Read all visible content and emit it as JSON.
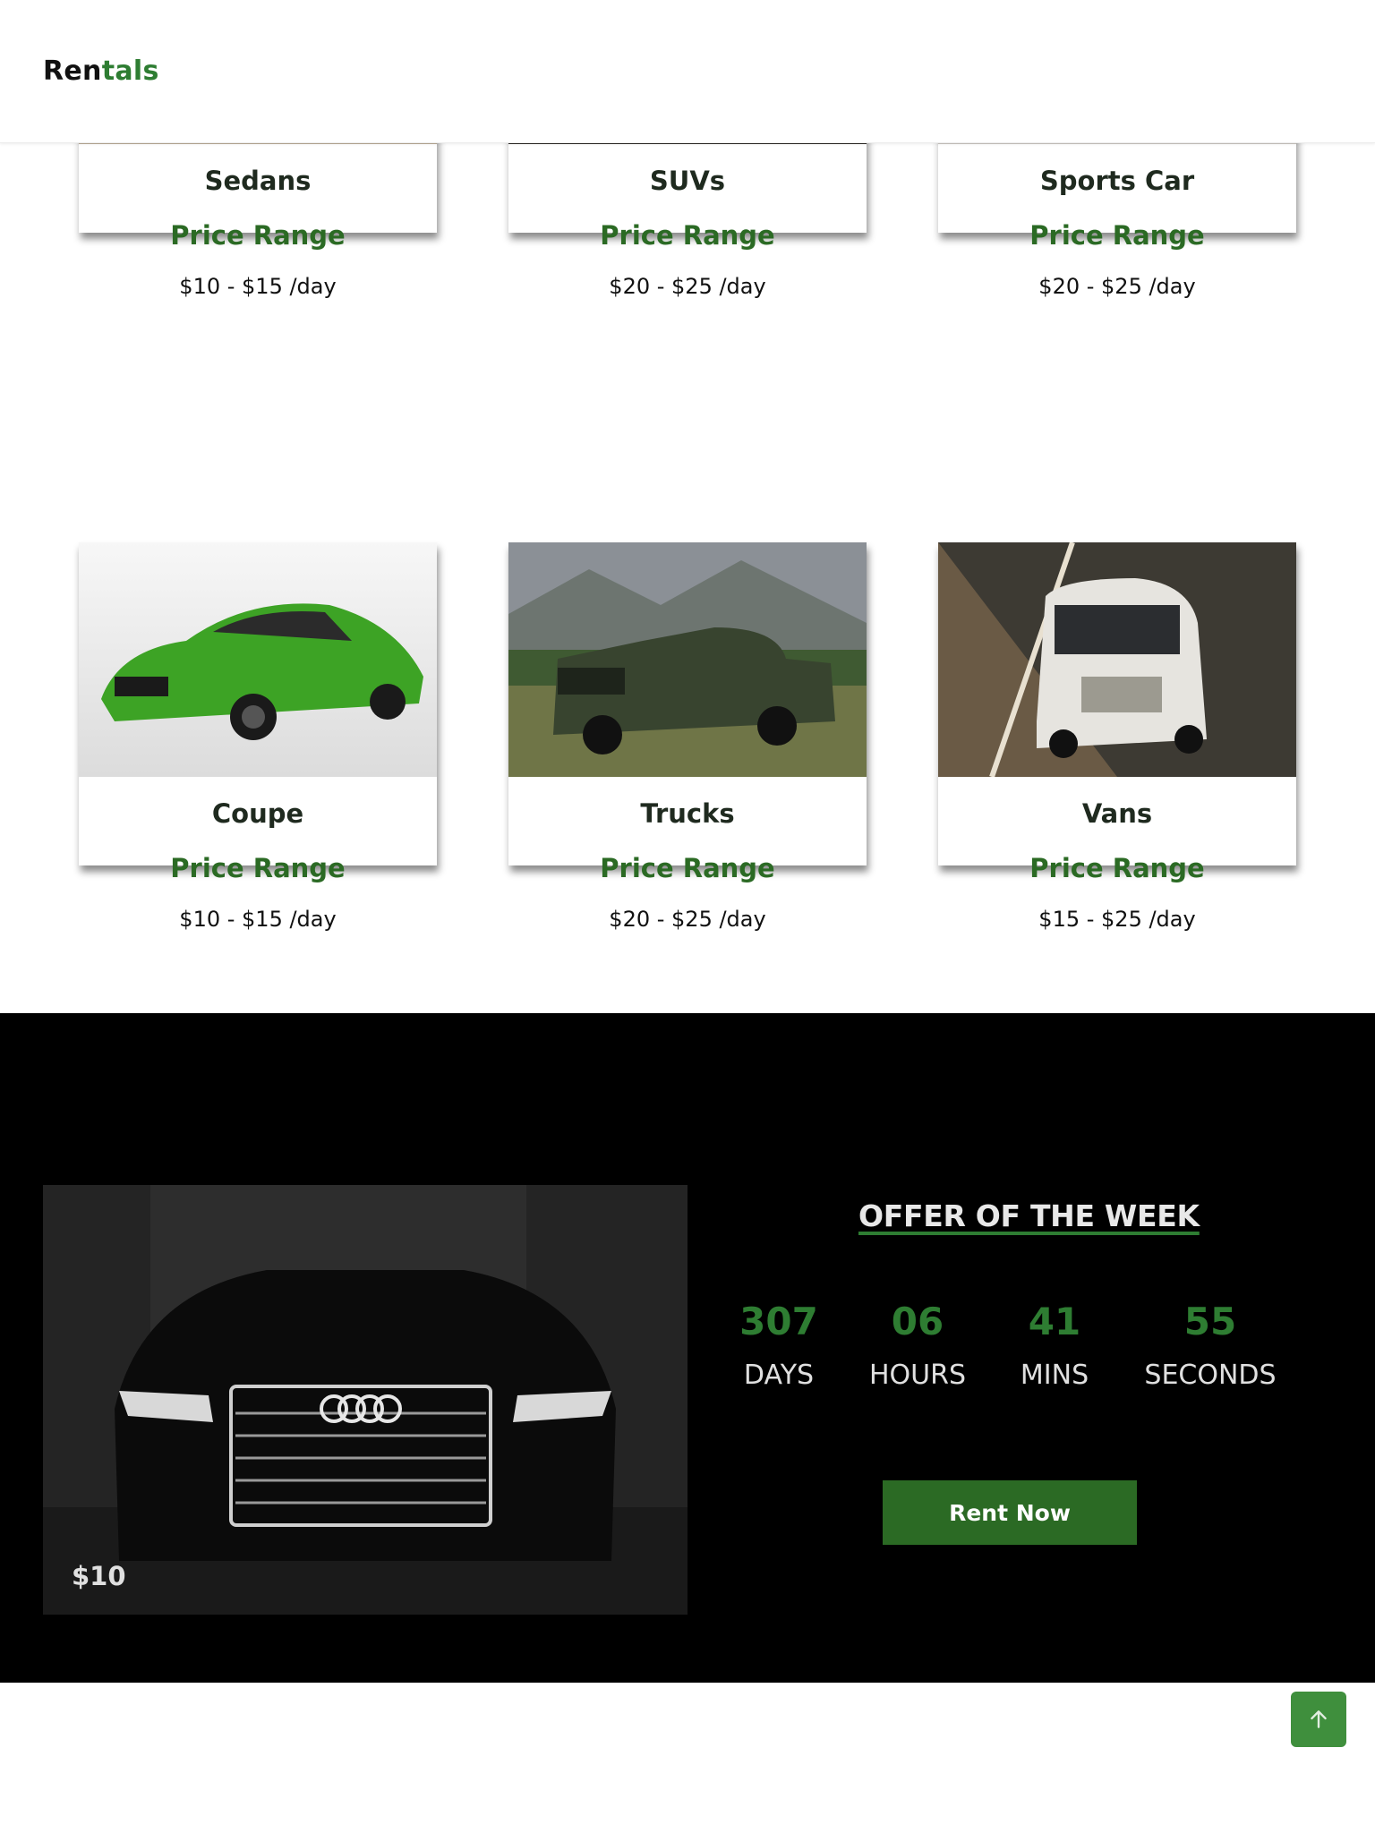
{
  "header": {
    "logo_part1": "Ren",
    "logo_part2": "tals"
  },
  "cards": [
    {
      "title": "Sedans",
      "range_label": "Price Range",
      "range_value": "$10 - $15 /day",
      "image": "red-sedan"
    },
    {
      "title": "SUVs",
      "range_label": "Price Range",
      "range_value": "$20 - $25 /day",
      "image": "dark-suv"
    },
    {
      "title": "Sports Car",
      "range_label": "Price Range",
      "range_value": "$20 - $25 /day",
      "image": "red-muscle-car"
    },
    {
      "title": "Coupe",
      "range_label": "Price Range",
      "range_value": "$10 - $15 /day",
      "image": "green-coupe"
    },
    {
      "title": "Trucks",
      "range_label": "Price Range",
      "range_value": "$20 - $25 /day",
      "image": "green-pickup-truck"
    },
    {
      "title": "Vans",
      "range_label": "Price Range",
      "range_value": "$15 - $25 /day",
      "image": "white-van"
    }
  ],
  "offer": {
    "title": "OFFER OF THE WEEK",
    "price": "$10",
    "image": "black-luxury-sedan",
    "countdown": {
      "days": "307",
      "days_label": "DAYS",
      "hours": "06",
      "hours_label": "HOURS",
      "mins": "41",
      "mins_label": "MINS",
      "secs": "55",
      "secs_label": "SECONDS"
    },
    "button_label": "Rent Now"
  },
  "back_to_top": {
    "icon": "arrow-up-icon"
  },
  "colors": {
    "accent": "#2e7d32",
    "button": "#2b6a24",
    "offer_bg": "#000000"
  }
}
